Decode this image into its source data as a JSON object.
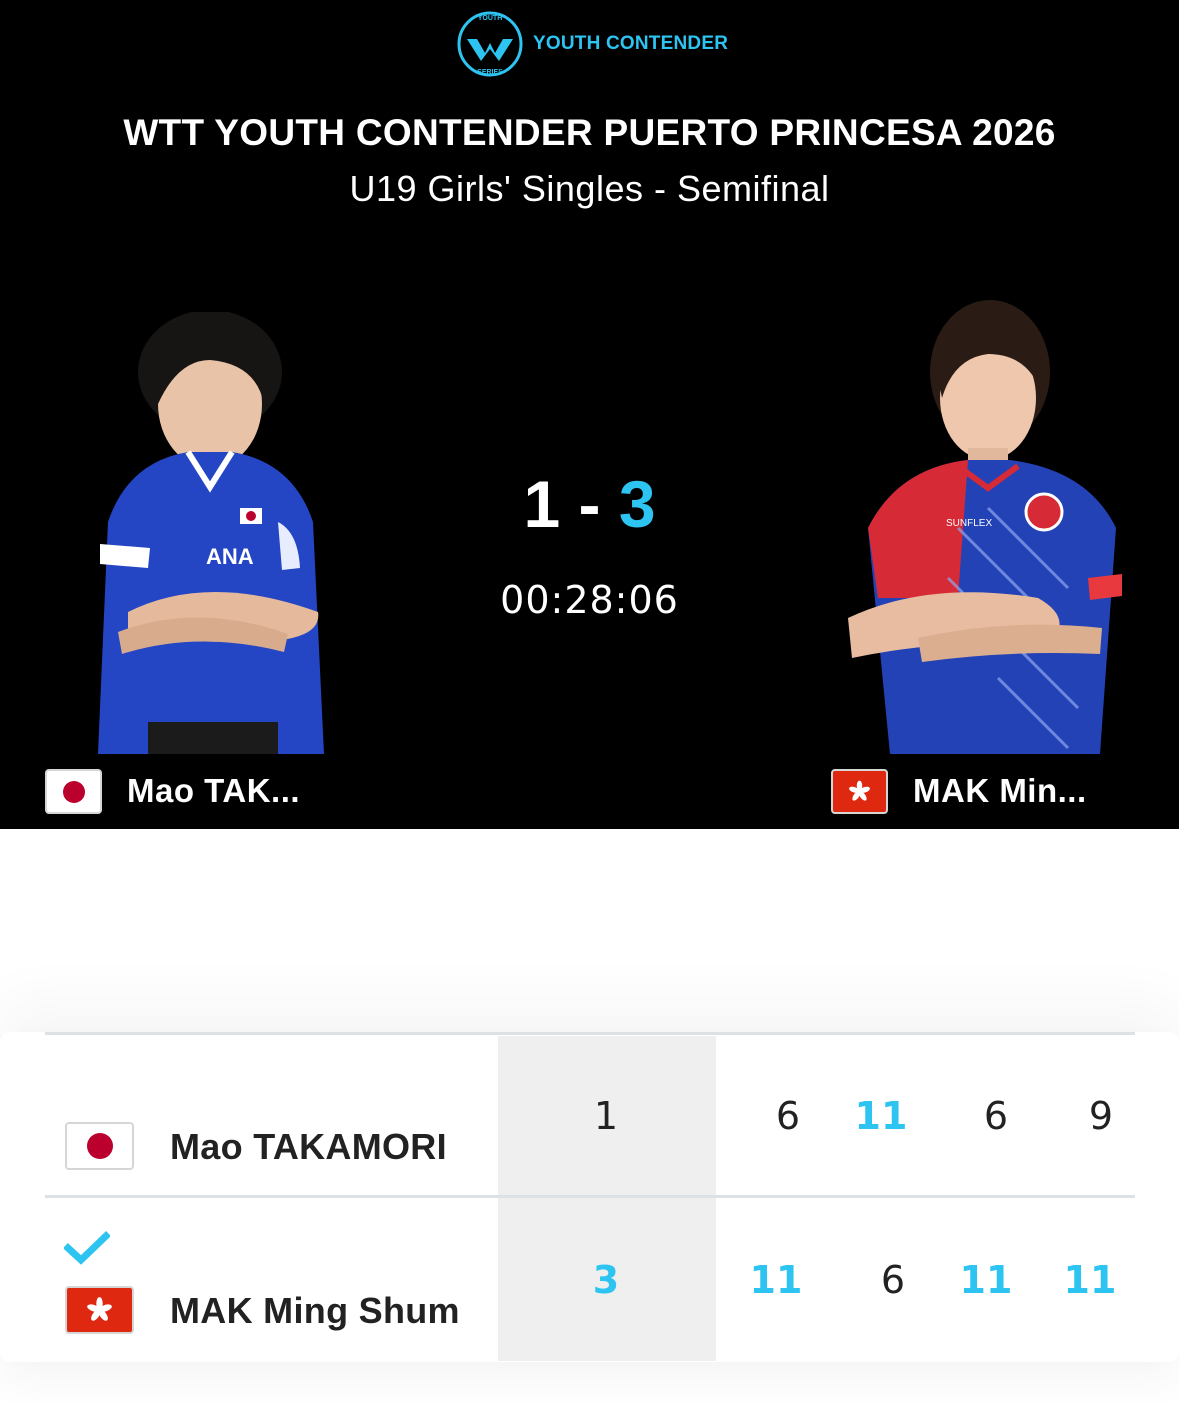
{
  "header": {
    "logo_text": "YOUTH CONTENDER",
    "logo_badge_top": "YOUTH",
    "logo_badge_bottom": "SERIES",
    "event_title": "WTT YOUTH CONTENDER PUERTO PRINCESA 2026",
    "event_subtitle": "U19 Girls' Singles - Semifinal"
  },
  "match": {
    "score_left": "1",
    "score_separator": "-",
    "score_right": "3",
    "elapsed_time": "00:28:06"
  },
  "players": [
    {
      "short_name": "Mao TAK...",
      "full_name": "Mao TAKAMORI",
      "country_flag": "japan-flag-icon",
      "games_won": "1",
      "game_scores": [
        "6",
        "11",
        "6",
        "9"
      ],
      "winner": false
    },
    {
      "short_name": "MAK Min...",
      "full_name": "MAK Ming Shum",
      "country_flag": "hong-kong-flag-icon",
      "games_won": "3",
      "game_scores": [
        "11",
        "6",
        "11",
        "11"
      ],
      "winner": true
    }
  ],
  "colors": {
    "accent": "#2ec4f2",
    "header_bg": "#000000",
    "games_col_bg": "#efefef",
    "japan_red": "#bc002d",
    "hong_kong_red": "#de2910"
  }
}
